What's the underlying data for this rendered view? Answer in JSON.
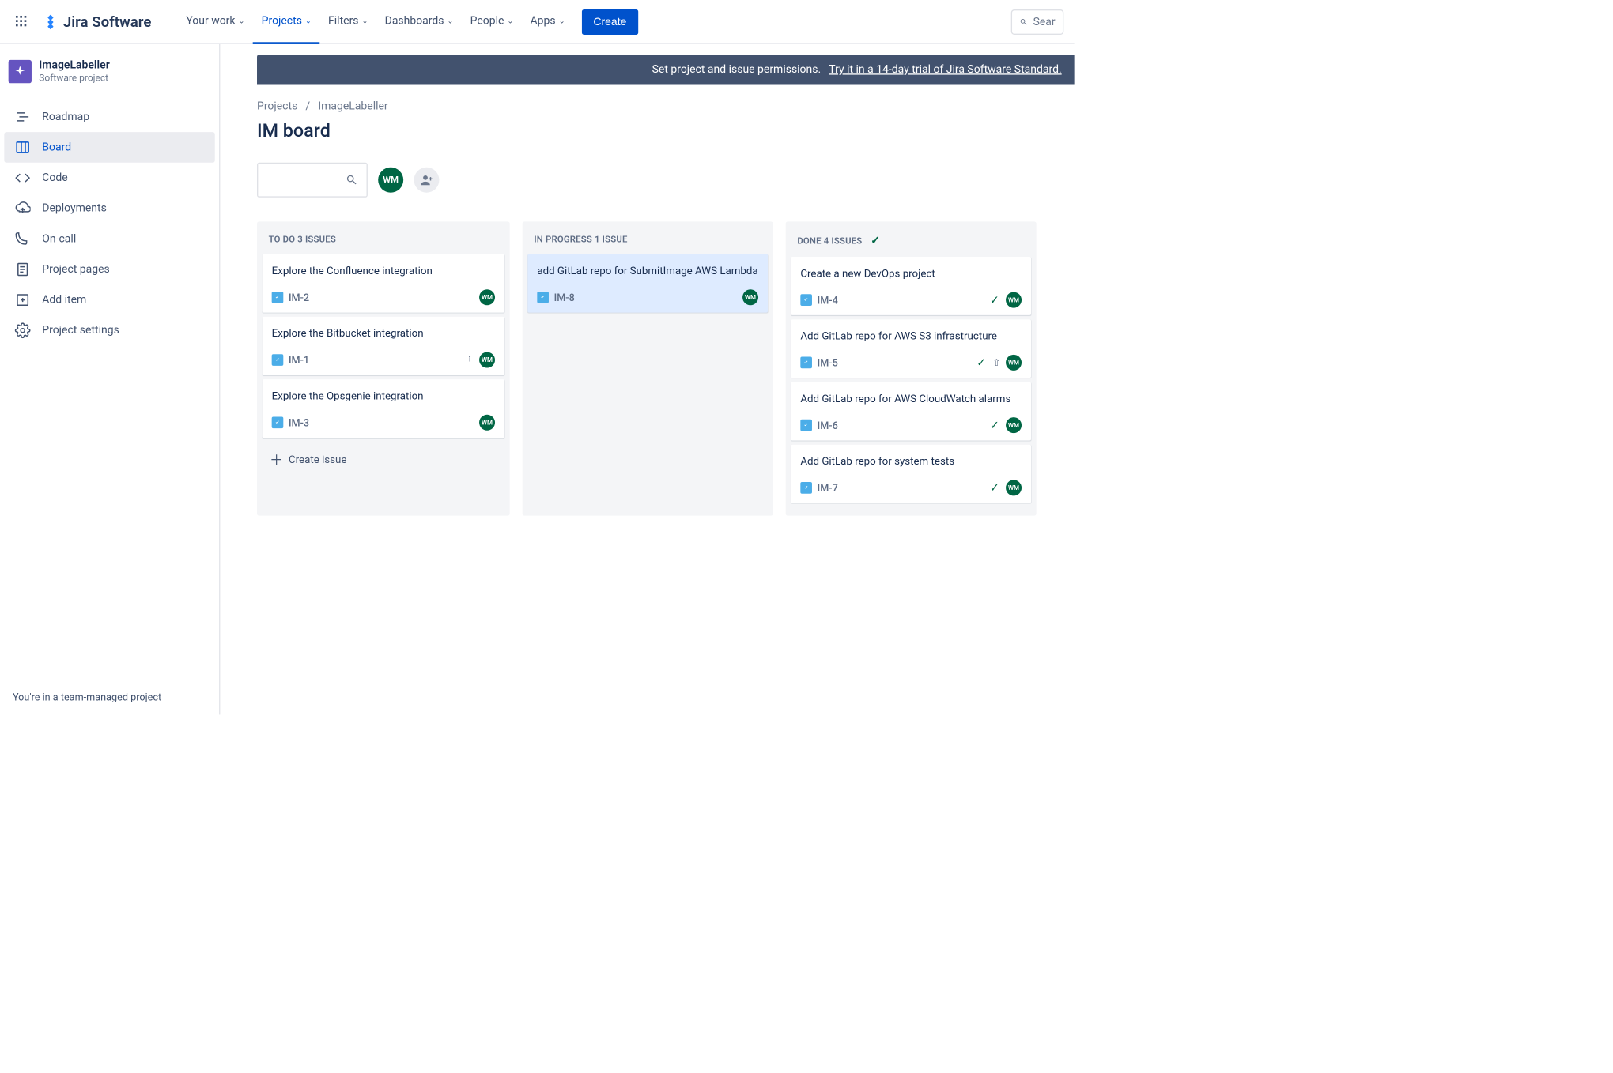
{
  "topnav": {
    "logo_text": "Jira Software",
    "items": [
      {
        "label": "Your work"
      },
      {
        "label": "Projects"
      },
      {
        "label": "Filters"
      },
      {
        "label": "Dashboards"
      },
      {
        "label": "People"
      },
      {
        "label": "Apps"
      }
    ],
    "create_label": "Create",
    "search_placeholder": "Sear"
  },
  "sidebar": {
    "project_name": "ImageLabeller",
    "project_type": "Software project",
    "items": [
      {
        "label": "Roadmap"
      },
      {
        "label": "Board"
      },
      {
        "label": "Code"
      },
      {
        "label": "Deployments"
      },
      {
        "label": "On-call"
      },
      {
        "label": "Project pages"
      },
      {
        "label": "Add item"
      },
      {
        "label": "Project settings"
      }
    ],
    "footer_text": "You're in a team-managed project"
  },
  "banner": {
    "text": "Set project and issue permissions.",
    "link_text": "Try it in a 14-day trial of Jira Software Standard."
  },
  "breadcrumb": {
    "root": "Projects",
    "project": "ImageLabeller"
  },
  "board_title": "IM board",
  "avatars": {
    "wm": "WM"
  },
  "columns": [
    {
      "header": "TO DO 3 ISSUES",
      "cards": [
        {
          "title": "Explore the Confluence integration",
          "key": "IM-2",
          "assignee": "WM"
        },
        {
          "title": "Explore the Bitbucket integration",
          "key": "IM-1",
          "assignee": "WM",
          "priority": "medium"
        },
        {
          "title": "Explore the Opsgenie integration",
          "key": "IM-3",
          "assignee": "WM"
        }
      ],
      "create_label": "Create issue"
    },
    {
      "header": "IN PROGRESS 1 ISSUE",
      "cards": [
        {
          "title": "add GitLab repo for SubmitImage AWS Lambda",
          "key": "IM-8",
          "assignee": "WM",
          "highlight": true
        }
      ]
    },
    {
      "header": "DONE 4 ISSUES",
      "done_check": true,
      "cards": [
        {
          "title": "Create a new DevOps project",
          "key": "IM-4",
          "assignee": "WM",
          "done": true
        },
        {
          "title": "Add GitLab repo for AWS S3 infrastructure",
          "key": "IM-5",
          "assignee": "WM",
          "done": true,
          "up": true
        },
        {
          "title": "Add GitLab repo for AWS CloudWatch alarms",
          "key": "IM-6",
          "assignee": "WM",
          "done": true
        },
        {
          "title": "Add GitLab repo for system tests",
          "key": "IM-7",
          "assignee": "WM",
          "done": true
        }
      ]
    }
  ]
}
